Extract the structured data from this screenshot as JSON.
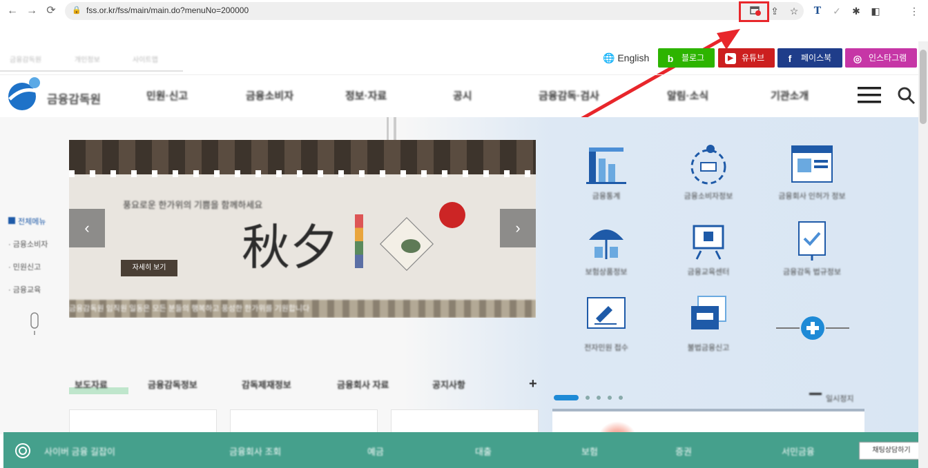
{
  "browser": {
    "url": "fss.or.kr/fss/main/main.do?menuNo=200000",
    "nav": {
      "back": "←",
      "forward": "→",
      "reload": "⟳"
    },
    "toolbar_icons": [
      "extension-alert-icon",
      "share-icon",
      "star-icon",
      "translate-icon",
      "check-icon",
      "puzzle-icon",
      "sidepanel-icon",
      "menu-icon"
    ],
    "highlight_color": "#e8262b"
  },
  "header": {
    "util_links": [
      "금융감독원",
      "개인정보",
      "사이트맵"
    ],
    "language": "English",
    "sns": [
      {
        "label": "블로그",
        "color": "#2db400",
        "glyph": "b"
      },
      {
        "label": "유튜브",
        "color": "#cc1f1f",
        "glyph": "▶"
      },
      {
        "label": "페이스북",
        "color": "#1f3d8a",
        "glyph": "f"
      },
      {
        "label": "인스타그램",
        "color": "#c636a6",
        "glyph": "◎"
      }
    ],
    "logo_text": "금융감독원",
    "gnb": [
      "민원·신고",
      "금융소비자",
      "정보·자료",
      "공시",
      "금융감독·검사",
      "알림·소식",
      "기관소개"
    ]
  },
  "banner": {
    "title": "풍요로운 한가위의 기쁨을 함께하세요",
    "calligraphy": "秋夕",
    "more_label": "자세히 보기",
    "prev": "‹",
    "next": "›",
    "bottom_text": "금융감독원 임직원 일동은 모든 분들의 행복하고 풍성한 한가위를 기원합니다"
  },
  "sidebar": {
    "items": [
      "전체메뉴",
      "금융소비자",
      "민원신고",
      "금융교육"
    ]
  },
  "quick_menu": [
    {
      "label": "금융통계",
      "icon": "statistics-icon"
    },
    {
      "label": "금융소비자정보",
      "icon": "consumer-info-icon"
    },
    {
      "label": "금융회사 인허가 정보",
      "icon": "license-info-icon"
    },
    {
      "label": "보험상품정보",
      "icon": "umbrella-icon"
    },
    {
      "label": "금융교육센터",
      "icon": "education-icon"
    },
    {
      "label": "금융감독 법규정보",
      "icon": "regulation-icon"
    },
    {
      "label": "전자민원 접수",
      "icon": "complaint-icon"
    },
    {
      "label": "불법금융신고",
      "icon": "report-icon"
    },
    {
      "label": "더보기",
      "icon": "plus-icon"
    }
  ],
  "tabs": [
    "보도자료",
    "금융감독정보",
    "감독제재정보",
    "금융회사 자료",
    "공지사항"
  ],
  "tabs_more": "+",
  "slide_indicator": {
    "pause": "일시정지"
  },
  "footer": {
    "title": "사이버 금융 길잡이",
    "items": [
      "금융회사 조회",
      "예금",
      "대출",
      "보험",
      "증권",
      "서민금융"
    ],
    "chat": "채팅상담하기"
  }
}
